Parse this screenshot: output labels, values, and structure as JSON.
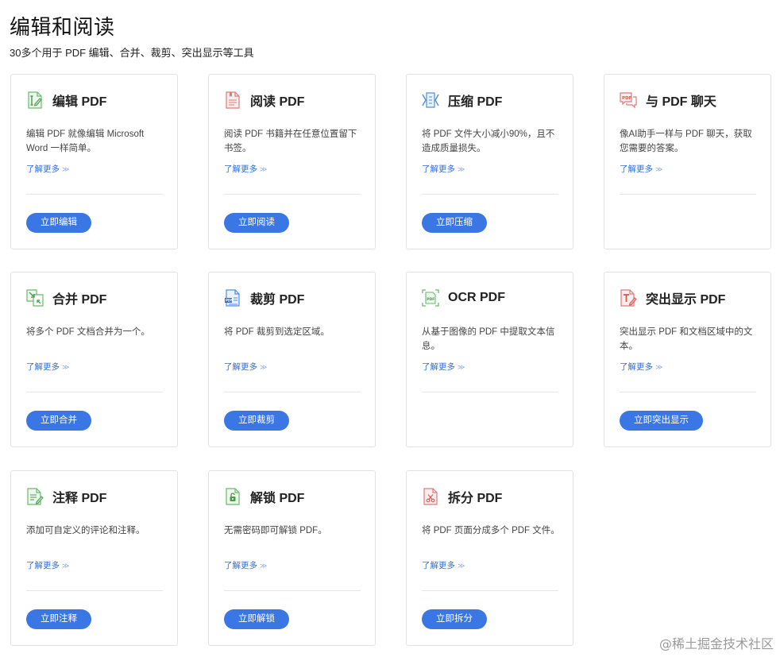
{
  "header": {
    "title": "编辑和阅读",
    "subtitle": "30多个用于 PDF 编辑、合并、裁剪、突出显示等工具"
  },
  "cards": [
    {
      "title": "编辑 PDF",
      "desc": "编辑 PDF 就像编辑 Microsoft Word 一样简单。",
      "more": "了解更多",
      "button": "立即编辑",
      "icon": "edit-pdf-icon"
    },
    {
      "title": "阅读 PDF",
      "desc": "阅读 PDF 书籍并在任意位置留下书签。",
      "more": "了解更多",
      "button": "立即阅读",
      "icon": "read-pdf-icon"
    },
    {
      "title": "压缩 PDF",
      "desc": "将 PDF 文件大小减小90%，且不造成质量损失。",
      "more": "了解更多",
      "button": "立即压缩",
      "icon": "compress-pdf-icon"
    },
    {
      "title": "与 PDF 聊天",
      "desc": "像AI助手一样与 PDF 聊天，获取您需要的答案。",
      "more": "了解更多",
      "button": "",
      "icon": "chat-pdf-icon"
    },
    {
      "title": "合并 PDF",
      "desc": "将多个 PDF 文档合并为一个。",
      "more": "了解更多",
      "button": "立即合并",
      "icon": "merge-pdf-icon"
    },
    {
      "title": "裁剪 PDF",
      "desc": "将 PDF 裁剪到选定区域。",
      "more": "了解更多",
      "button": "立即裁剪",
      "icon": "crop-pdf-icon"
    },
    {
      "title": "OCR PDF",
      "desc": "从基于图像的 PDF 中提取文本信息。",
      "more": "了解更多",
      "button": "",
      "icon": "ocr-pdf-icon"
    },
    {
      "title": "突出显示 PDF",
      "desc": "突出显示 PDF 和文档区域中的文本。",
      "more": "了解更多",
      "button": "立即突出显示",
      "icon": "highlight-pdf-icon"
    },
    {
      "title": "注释 PDF",
      "desc": "添加可自定义的评论和注释。",
      "more": "了解更多",
      "button": "立即注释",
      "icon": "annotate-pdf-icon"
    },
    {
      "title": "解锁 PDF",
      "desc": "无需密码即可解锁 PDF。",
      "more": "了解更多",
      "button": "立即解锁",
      "icon": "unlock-pdf-icon"
    },
    {
      "title": "拆分 PDF",
      "desc": "将 PDF 页面分成多个 PDF 文件。",
      "more": "了解更多",
      "button": "立即拆分",
      "icon": "split-pdf-icon"
    }
  ],
  "more_chevron": "≫",
  "watermark": "@稀土掘金技术社区",
  "colors": {
    "accent": "#3b76e5",
    "link": "#2e6fdc",
    "border": "#e3e3e3"
  }
}
